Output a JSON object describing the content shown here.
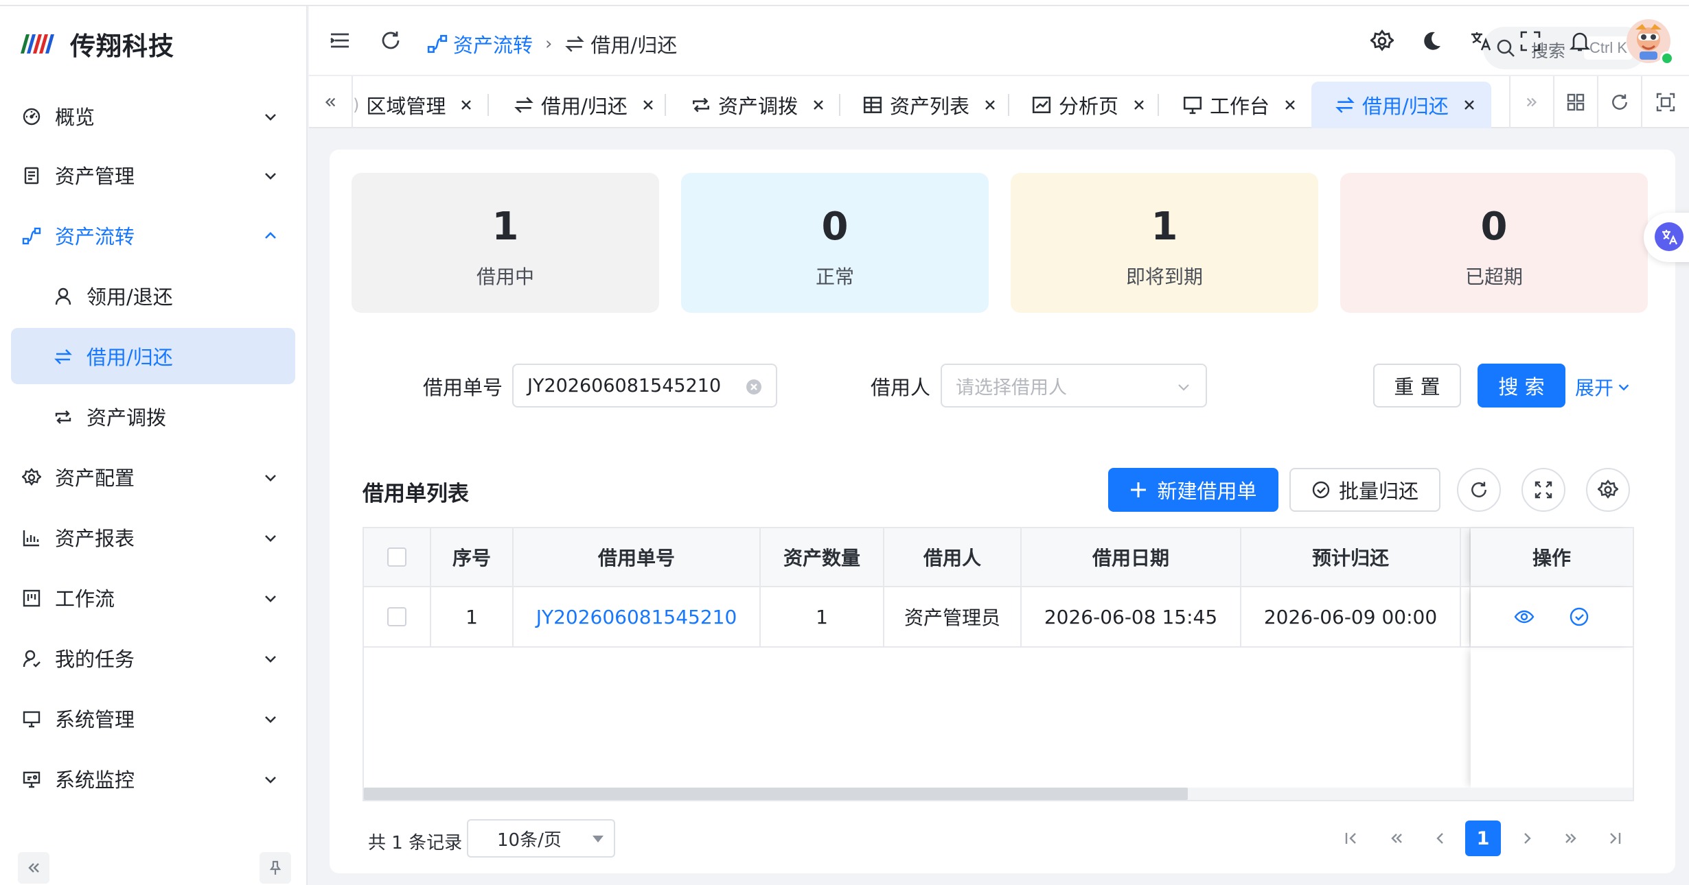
{
  "brand": {
    "name": "传翔科技"
  },
  "sidebar": {
    "items": [
      {
        "label": "概览",
        "icon": "dashboard-icon"
      },
      {
        "label": "资产管理",
        "icon": "document-icon"
      },
      {
        "label": "资产流转",
        "icon": "flow-icon"
      },
      {
        "label": "领用/退还",
        "icon": "user-icon"
      },
      {
        "label": "借用/归还",
        "icon": "swap-icon"
      },
      {
        "label": "资产调拨",
        "icon": "repeat-icon"
      },
      {
        "label": "资产配置",
        "icon": "gear-icon"
      },
      {
        "label": "资产报表",
        "icon": "bar-chart-icon"
      },
      {
        "label": "工作流",
        "icon": "kanban-icon"
      },
      {
        "label": "我的任务",
        "icon": "user-task-icon"
      },
      {
        "label": "系统管理",
        "icon": "monitor-icon"
      },
      {
        "label": "系统监控",
        "icon": "monitor-gear-icon"
      }
    ]
  },
  "header": {
    "breadcrumb": [
      "资产流转",
      "借用/归还"
    ],
    "search_label": "搜索",
    "search_shortcut": "Ctrl K"
  },
  "tabs": [
    {
      "label": "区域管理"
    },
    {
      "label": "借用/归还"
    },
    {
      "label": "资产调拨"
    },
    {
      "label": "资产列表"
    },
    {
      "label": "分析页"
    },
    {
      "label": "工作台"
    },
    {
      "label": "借用/归还"
    }
  ],
  "stats": [
    {
      "value": "1",
      "label": "借用中",
      "color": "#f2f2f2"
    },
    {
      "value": "0",
      "label": "正常",
      "color": "#e6f6fe"
    },
    {
      "value": "1",
      "label": "即将到期",
      "color": "#fdf6e3"
    },
    {
      "value": "0",
      "label": "已超期",
      "color": "#fdeeee"
    }
  ],
  "filters": {
    "order_no_label": "借用单号",
    "order_no_value": "JY202606081545210",
    "borrower_label": "借用人",
    "borrower_placeholder": "请选择借用人",
    "reset_label": "重 置",
    "search_label": "搜 索",
    "expand_label": "展开"
  },
  "table_section": {
    "title": "借用单列表",
    "new_button": "新建借用单",
    "batch_return_button": "批量归还"
  },
  "table": {
    "columns": [
      "序号",
      "借用单号",
      "资产数量",
      "借用人",
      "借用日期",
      "预计归还",
      "操作"
    ],
    "rows": [
      {
        "index": "1",
        "order_no": "JY202606081545210",
        "quantity": "1",
        "borrower": "资产管理员",
        "borrow_date": "2026-06-08 15:45",
        "due_date": "2026-06-09 00:00"
      }
    ]
  },
  "pagination": {
    "total_text": "共 1 条记录",
    "page_size": "10条/页",
    "current_page": "1"
  },
  "colors": {
    "primary": "#1677ff"
  }
}
